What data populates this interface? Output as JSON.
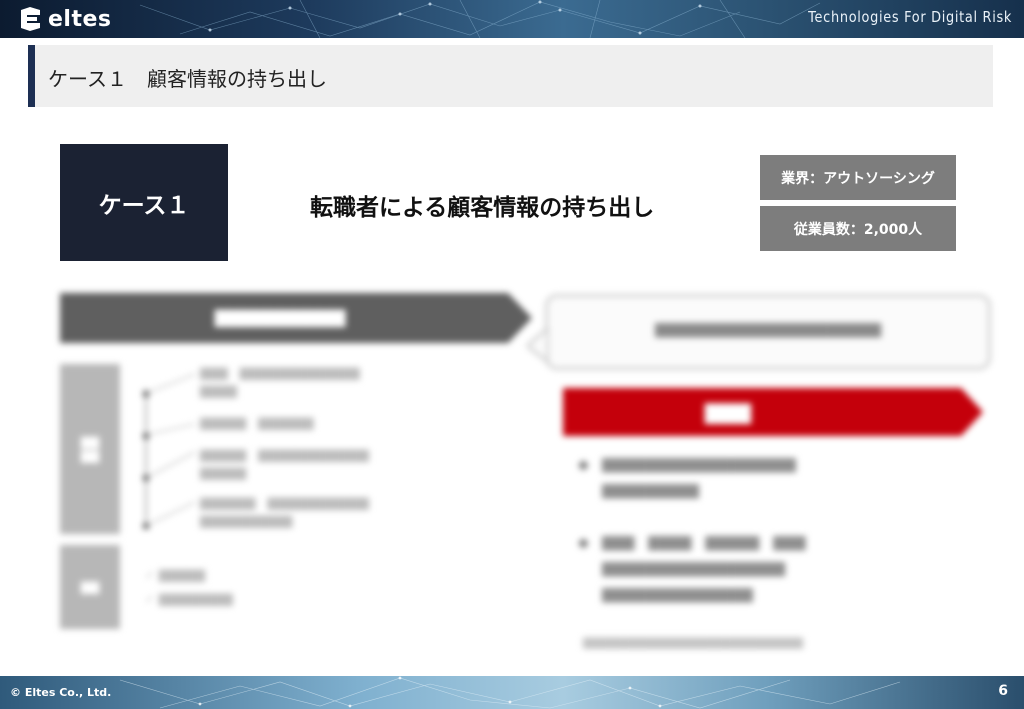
{
  "header": {
    "logo_text": "eltes",
    "tagline": "Technologies For Digital Risk"
  },
  "title": {
    "text": "ケース１　顧客情報の持ち出し"
  },
  "case": {
    "label": "ケース１",
    "headline": "転職者による顧客情報の持ち出し",
    "industry_tag": "業界：アウトソーシング",
    "employees_tag": "従業員数：2,000人"
  },
  "footer": {
    "copyright": "© Eltes Co., Ltd.",
    "page_number": "6"
  },
  "colors": {
    "header_dark": "#0c1b30",
    "accent_navy": "#1d2f53",
    "case_box": "#1b2233",
    "tag_gray": "#7d7d7d",
    "point_red": "#c4000b"
  }
}
